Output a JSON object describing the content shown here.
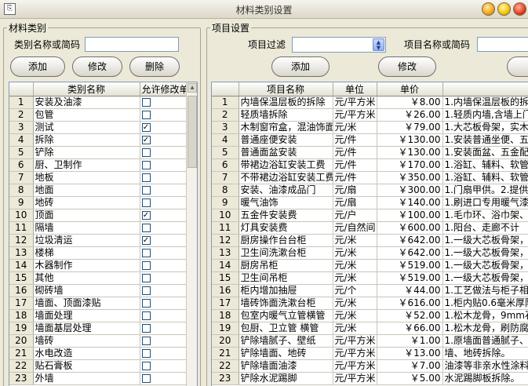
{
  "window": {
    "title": "材料类别设置"
  },
  "left": {
    "group_title": "材料类别",
    "search_label": "类别名称或简码",
    "search_value": "",
    "add_label": "添加",
    "edit_label": "修改",
    "delete_label": "删除",
    "columns": [
      "类别名称",
      "允许修改单"
    ],
    "rows": [
      {
        "n": "1",
        "name": "安装及油漆",
        "checked": false
      },
      {
        "n": "2",
        "name": "包管",
        "checked": false
      },
      {
        "n": "3",
        "name": "测试",
        "checked": true
      },
      {
        "n": "4",
        "name": "拆除",
        "checked": true
      },
      {
        "n": "5",
        "name": "铲除",
        "checked": false
      },
      {
        "n": "6",
        "name": "厨、卫制作",
        "checked": false
      },
      {
        "n": "7",
        "name": "地板",
        "checked": false
      },
      {
        "n": "8",
        "name": "地面",
        "checked": false
      },
      {
        "n": "9",
        "name": "地砖",
        "checked": false
      },
      {
        "n": "10",
        "name": "顶面",
        "checked": true
      },
      {
        "n": "11",
        "name": "隔墙",
        "checked": false
      },
      {
        "n": "12",
        "name": "垃圾清运",
        "checked": true
      },
      {
        "n": "13",
        "name": "楼梯",
        "checked": false
      },
      {
        "n": "14",
        "name": "木器制作",
        "checked": false
      },
      {
        "n": "15",
        "name": "其他",
        "checked": false
      },
      {
        "n": "16",
        "name": "砌砖墙",
        "checked": false
      },
      {
        "n": "17",
        "name": "墙面、顶面漆贴",
        "checked": false
      },
      {
        "n": "18",
        "name": "墙面处理",
        "checked": false
      },
      {
        "n": "19",
        "name": "墙面基层处理",
        "checked": false
      },
      {
        "n": "20",
        "name": "墙砖",
        "checked": false
      },
      {
        "n": "21",
        "name": "水电改造",
        "checked": false
      },
      {
        "n": "22",
        "name": "贴石膏板",
        "checked": false
      },
      {
        "n": "23",
        "name": "外墙",
        "checked": false
      }
    ]
  },
  "right": {
    "group_title": "项目设置",
    "filter_label": "项目过滤",
    "filter_value": "",
    "search_label": "项目名称或简码",
    "add_label": "添加",
    "edit_label": "修改",
    "columns": [
      "项目名称",
      "单位",
      "单价",
      ""
    ],
    "rows": [
      {
        "n": "1",
        "name": "内墙保温层板的拆除",
        "unit": "元/平方米",
        "price": "￥8.00",
        "desc": "1.内墙保温层板的拆除"
      },
      {
        "n": "2",
        "name": "轻质墙拆除",
        "unit": "元/平方米",
        "price": "￥26.00",
        "desc": "1.轻质内墙,含墙上门、"
      },
      {
        "n": "3",
        "name": "木制窗帘盒，混油饰面",
        "unit": "元/米",
        "price": "￥79.00",
        "desc": "1.大芯板骨架，实木收"
      },
      {
        "n": "4",
        "name": "普通座便安装",
        "unit": "元/件",
        "price": "￥130.00",
        "desc": "1.安装普通坐便、五金"
      },
      {
        "n": "5",
        "name": "普通面盆安装",
        "unit": "元/件",
        "price": "￥130.00",
        "desc": "1.安装面盆、五金配件"
      },
      {
        "n": "6",
        "name": "带裙边浴缸安装工费",
        "unit": "元/件",
        "price": "￥170.00",
        "desc": "1.浴缸、辅料、软管等"
      },
      {
        "n": "7",
        "name": "不带裙边浴缸安装工费",
        "unit": "元/件",
        "price": "￥350.00",
        "desc": "1.浴缸、辅料、软管等"
      },
      {
        "n": "8",
        "name": "安装、油漆成品门",
        "unit": "元/扇",
        "price": "￥300.00",
        "desc": "1.门扇甲供。2.提供忧"
      },
      {
        "n": "9",
        "name": "暖气油饰",
        "unit": "元/扇",
        "price": "￥140.00",
        "desc": "1.刷进口专用暖气漆。"
      },
      {
        "n": "10",
        "name": "五金件安装费",
        "unit": "元/户",
        "price": "￥100.00",
        "desc": "1.毛巾环、浴巾架、浴"
      },
      {
        "n": "11",
        "name": "灯具安装费",
        "unit": "元/自然间",
        "price": "￥600.00",
        "desc": "1.阳台、走廊不计"
      },
      {
        "n": "12",
        "name": "厨房操作台台柜",
        "unit": "元/米",
        "price": "￥642.00",
        "desc": "1.一级大芯板骨架，空"
      },
      {
        "n": "13",
        "name": "卫生间洗漱台柜",
        "unit": "元/米",
        "price": "￥642.00",
        "desc": "1.一级大芯板骨架，空"
      },
      {
        "n": "14",
        "name": "厨房吊柜",
        "unit": "元/米",
        "price": "￥519.00",
        "desc": "1.一级大芯板骨架，空"
      },
      {
        "n": "15",
        "name": "卫生间吊柜",
        "unit": "元/米",
        "price": "￥519.00",
        "desc": "1.一级大芯板骨架，空"
      },
      {
        "n": "16",
        "name": "柜内增加抽屉",
        "unit": "元/个",
        "price": "￥44.00",
        "desc": "1.工艺做法与柜子相同"
      },
      {
        "n": "17",
        "name": "墙砖饰面洗漱台柜",
        "unit": "元/米",
        "price": "￥616.00",
        "desc": "1.柜内贴0.6毫米厚防火"
      },
      {
        "n": "18",
        "name": "包室内暖气立管横管",
        "unit": "元/米",
        "price": "￥52.00",
        "desc": "1.松木龙骨，9mm石膏"
      },
      {
        "n": "19",
        "name": "包厨、卫立管 横管",
        "unit": "元/米",
        "price": "￥66.00",
        "desc": "1.松木龙骨，刷防腐涂"
      },
      {
        "n": "20",
        "name": "铲除墙腻子、壁纸",
        "unit": "元/平方米",
        "price": "￥1.00",
        "desc": "1.原墙面普通腻子、壁纸"
      },
      {
        "n": "21",
        "name": "铲除墙面、地砖",
        "unit": "元/平方米",
        "price": "￥13.00",
        "desc": "墙、地砖拆除。"
      },
      {
        "n": "22",
        "name": "铲除墙面油漆",
        "unit": "元/平方米",
        "price": "￥7.00",
        "desc": "油漆等非亲水性涂料。"
      },
      {
        "n": "23",
        "name": "铲除水泥踢脚",
        "unit": "元/平方米",
        "price": "￥5.00",
        "desc": "水泥踢脚板拆除。"
      }
    ]
  }
}
